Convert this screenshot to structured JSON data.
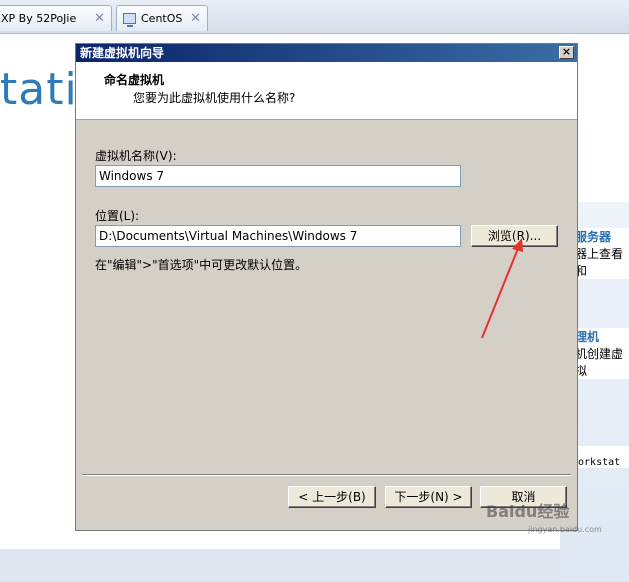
{
  "tabs": [
    {
      "label": "XP By 52PoJie"
    },
    {
      "label": "CentOS"
    }
  ],
  "background": {
    "title_fragment": "tatio",
    "side_items": [
      {
        "heading": "服务器",
        "text": "器上查看和"
      },
      {
        "heading": "理机",
        "text": "机创建虚拟"
      },
      {
        "text": "e Workstat"
      }
    ]
  },
  "dialog": {
    "title": "新建虚拟机向导",
    "close_label": "×",
    "header_title": "命名虚拟机",
    "header_subtitle": "您要为此虚拟机使用什么名称?",
    "name_label": "虚拟机名称(V):",
    "name_value": "Windows 7",
    "location_label": "位置(L):",
    "location_value": "D:\\Documents\\Virtual Machines\\Windows 7",
    "browse_label": "浏览(R)...",
    "hint": "在\"编辑\">\"首选项\"中可更改默认位置。",
    "back_label": "< 上一步(B)",
    "next_label": "下一步(N) >",
    "cancel_label": "取消"
  },
  "watermark": {
    "text": "Baidu经验",
    "sub": "jingyan.baidu.com"
  },
  "colors": {
    "titlebar": "#0a246a",
    "annotation": "#e53030",
    "accent": "#2f7ab8"
  }
}
